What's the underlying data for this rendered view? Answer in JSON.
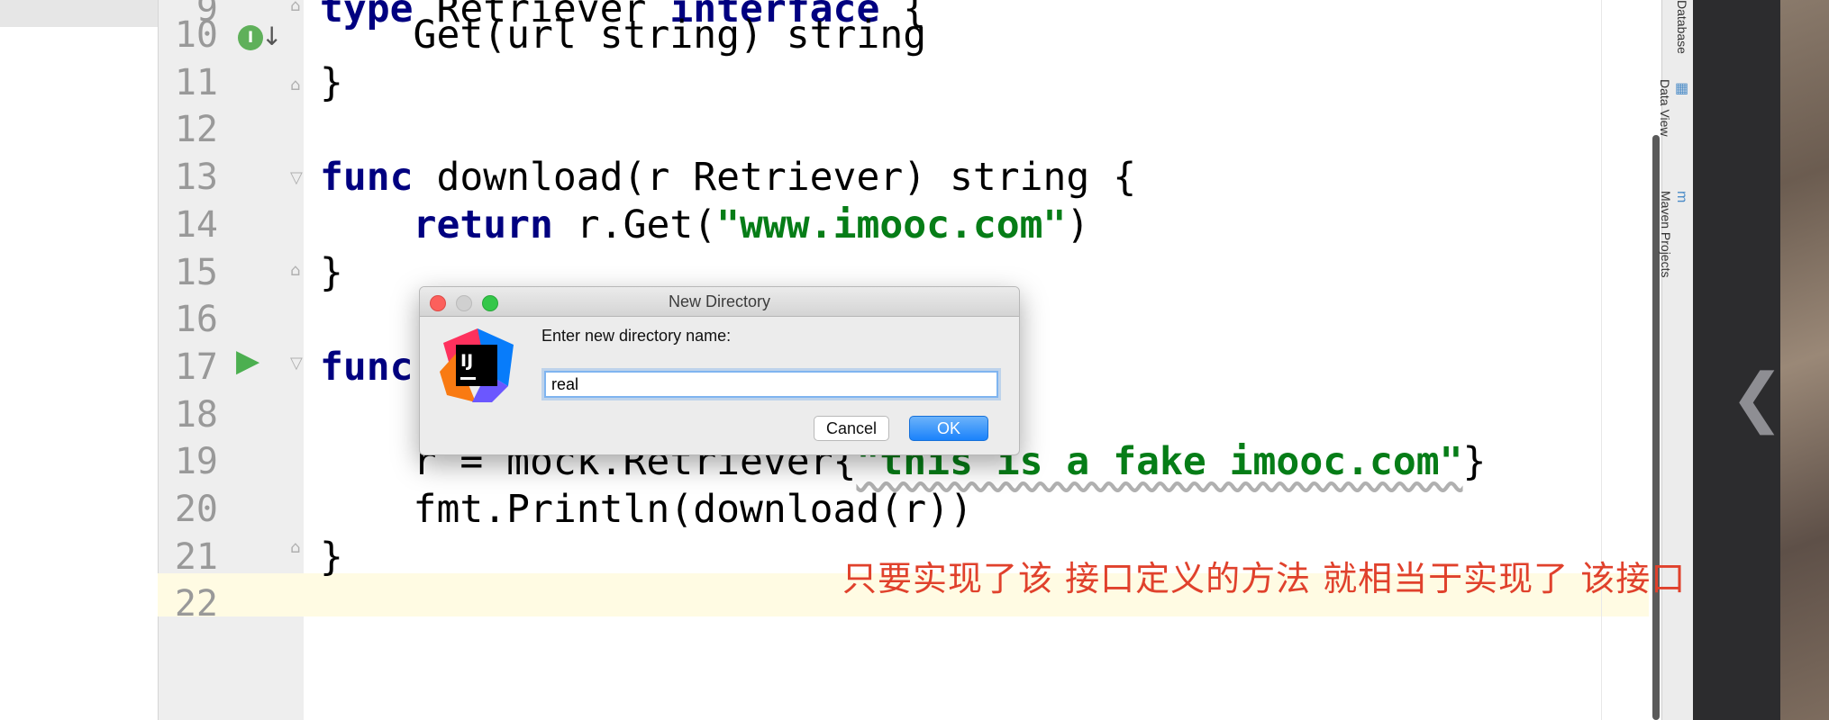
{
  "editor": {
    "lines": [
      {
        "num": "9",
        "segments": [
          {
            "t": "type ",
            "c": "kw"
          },
          {
            "t": "Retriever ",
            "c": ""
          },
          {
            "t": "interface",
            "c": "kw"
          },
          {
            "t": " {",
            "c": ""
          }
        ]
      },
      {
        "num": "10",
        "segments": [
          {
            "t": "    Get(url string) string",
            "c": ""
          }
        ]
      },
      {
        "num": "11",
        "segments": [
          {
            "t": "}",
            "c": ""
          }
        ]
      },
      {
        "num": "12",
        "segments": []
      },
      {
        "num": "13",
        "segments": [
          {
            "t": "func",
            "c": "kw"
          },
          {
            "t": " download(r Retriever) string {",
            "c": ""
          }
        ]
      },
      {
        "num": "14",
        "segments": [
          {
            "t": "    ",
            "c": ""
          },
          {
            "t": "return",
            "c": "kw"
          },
          {
            "t": " r.Get(",
            "c": ""
          },
          {
            "t": "\"www.imooc.com\"",
            "c": "str"
          },
          {
            "t": ")",
            "c": ""
          }
        ]
      },
      {
        "num": "15",
        "segments": [
          {
            "t": "}",
            "c": ""
          }
        ]
      },
      {
        "num": "16",
        "segments": []
      },
      {
        "num": "17",
        "segments": [
          {
            "t": "func",
            "c": "kw"
          }
        ]
      },
      {
        "num": "18",
        "segments": []
      },
      {
        "num": "19",
        "segments": [
          {
            "t": "    r = mock.Retriever{",
            "c": ""
          },
          {
            "t": "\"this is a fake imooc.com\"",
            "c": "str wavy"
          },
          {
            "t": "}",
            "c": ""
          }
        ]
      },
      {
        "num": "20",
        "segments": [
          {
            "t": "    fmt.Println(download(r))",
            "c": ""
          }
        ]
      },
      {
        "num": "21",
        "segments": [
          {
            "t": "}",
            "c": ""
          }
        ]
      },
      {
        "num": "22",
        "segments": []
      }
    ],
    "colors": {
      "keyword": "#000080",
      "string": "#067d17",
      "line_number": "#999999",
      "current_line": "#fffbe3"
    }
  },
  "gutter_icons": {
    "implements": "I",
    "run": "▶"
  },
  "tool_windows": [
    {
      "label": "Database",
      "icon": "database-icon"
    },
    {
      "label": "Data View",
      "icon": "table-icon"
    },
    {
      "label": "Maven Projects",
      "icon": "maven-icon",
      "glyph": "m"
    }
  ],
  "dialog": {
    "title": "New Directory",
    "prompt": "Enter new directory name:",
    "input_value": "real",
    "cancel_label": "Cancel",
    "ok_label": "OK",
    "logo_text": "IJ"
  },
  "caption": "只要实现了该 接口定义的方法 就相当于实现了 该接口",
  "side_panel": {
    "back_icon": "back-arrow-icon"
  }
}
